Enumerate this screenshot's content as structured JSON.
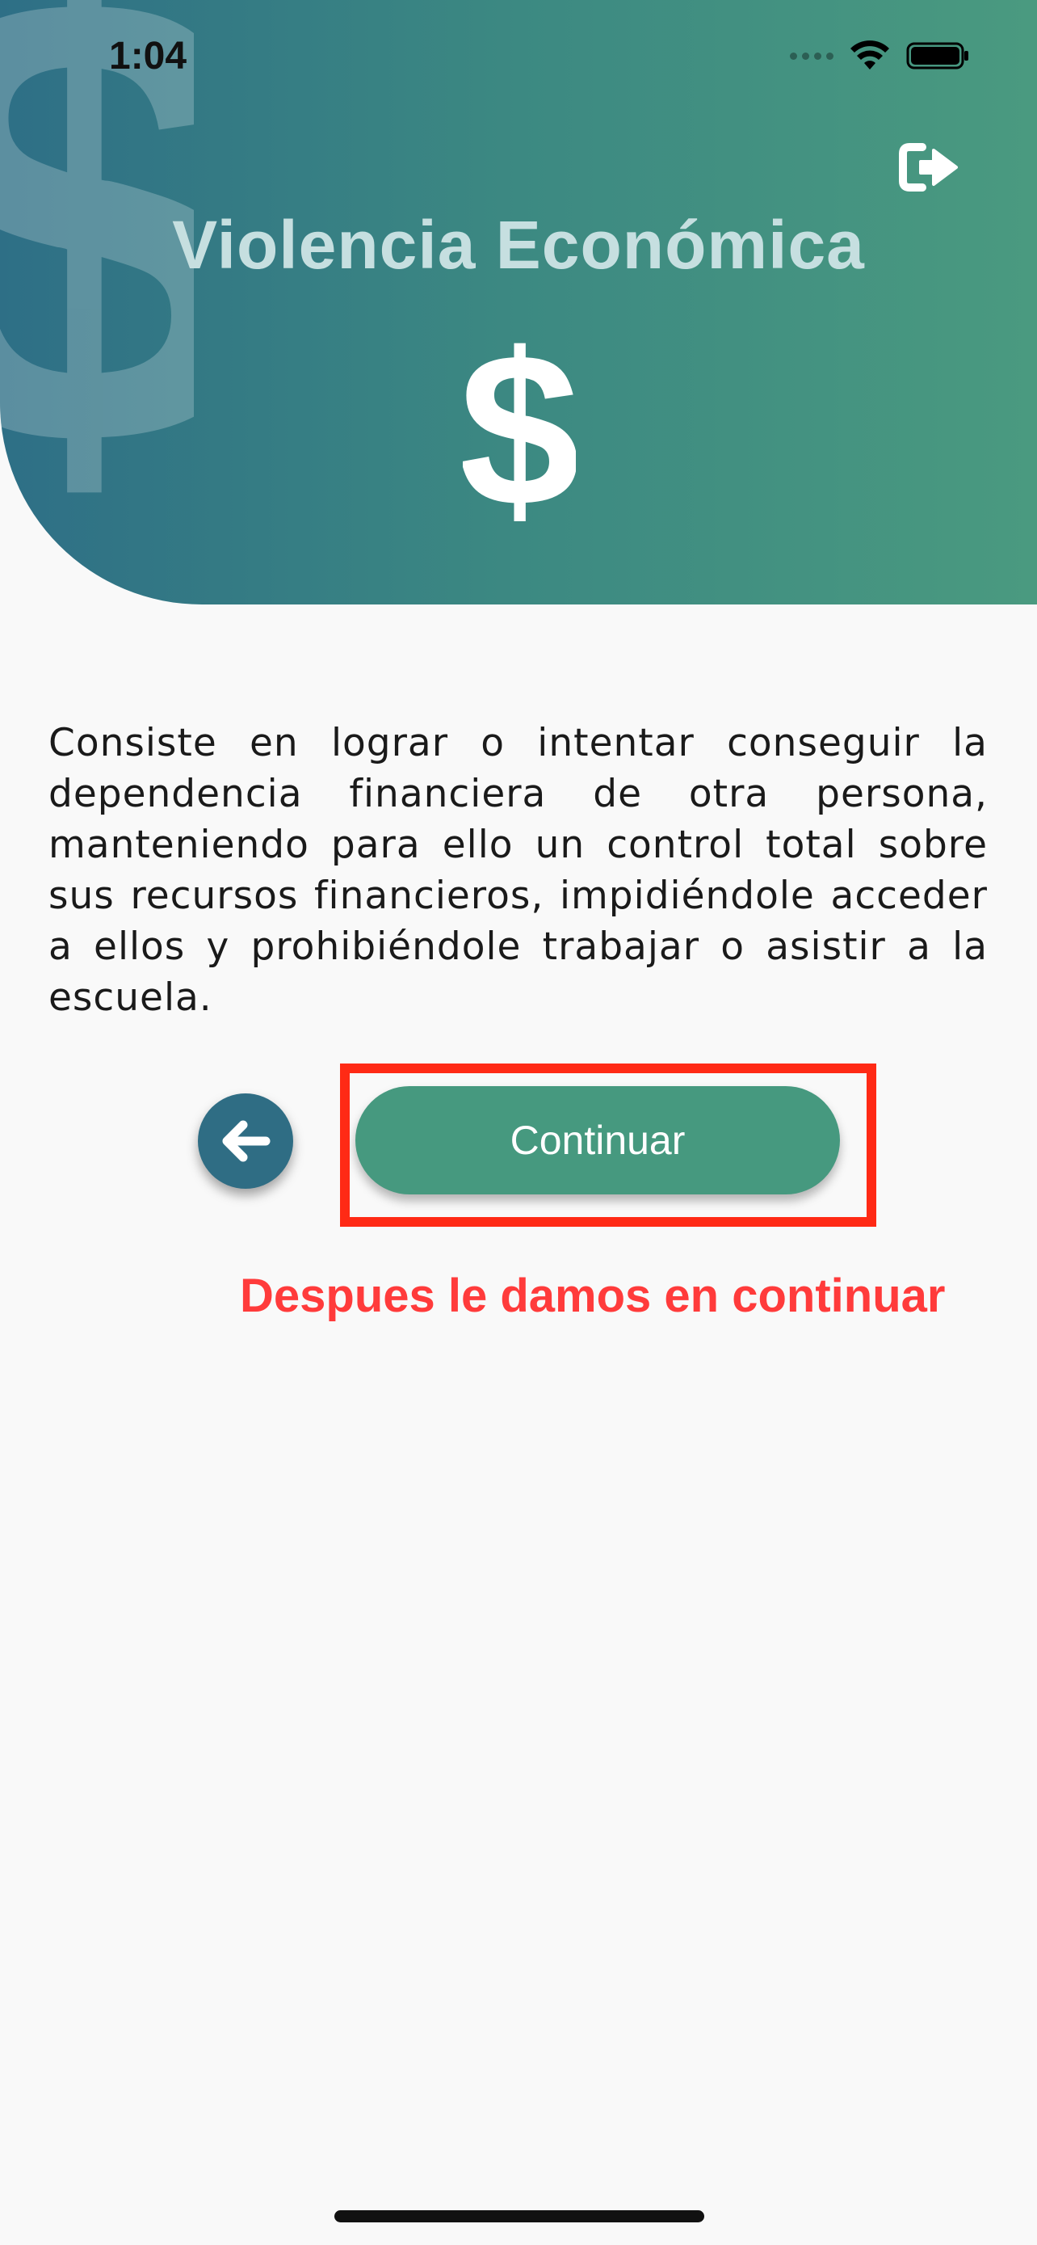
{
  "status_bar": {
    "time": "1:04"
  },
  "header": {
    "title": "Violencia Económica",
    "icon": "dollar-icon",
    "logout_icon": "logout-icon"
  },
  "content": {
    "description": "Consiste en lograr o intentar conseguir la dependencia financiera de otra persona, manteniendo para ello un control total sobre sus recursos financieros, impidiéndole acceder a ellos y prohibiéndole trabajar o asistir a la escuela."
  },
  "actions": {
    "back_icon": "arrow-left-icon",
    "continue_label": "Continuar"
  },
  "annotation": {
    "text": "Despues le damos en continuar"
  },
  "colors": {
    "header_gradient_start": "#2e6f86",
    "header_gradient_end": "#4a9a80",
    "continue_button": "#46997f",
    "back_button": "#2f6d84",
    "highlight": "#ff2a15",
    "annotation": "#ff3b3b"
  }
}
